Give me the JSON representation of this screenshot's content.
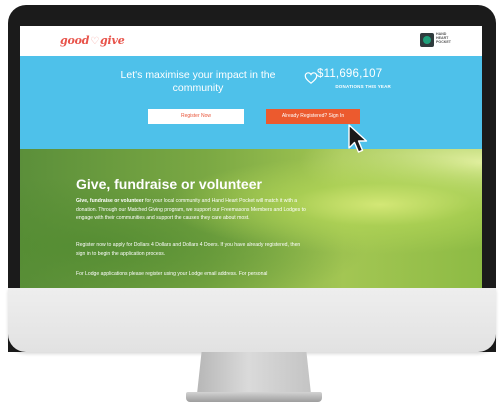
{
  "header": {
    "logo": {
      "left": "good",
      "heart": "♡",
      "right": "give"
    },
    "partner_logo_text": [
      "HAND",
      "HEART",
      "POCKET"
    ]
  },
  "hero": {
    "headline": "Let's maximise your impact in the community",
    "donation_amount": "$11,696,107",
    "donation_label": "DONATIONS THIS YEAR",
    "register_button": "Register Now",
    "signin_button": "Already Registered? Sign In"
  },
  "content": {
    "title": "Give, fundraise or volunteer",
    "para1_bold": "Give, fundraise or volunteer",
    "para1_rest": " for your local community and Hand Heart Pocket will match it with a donation. Through our Matched Giving program, we support our Freemasons Members and Lodges to engage with their communities and support the causes they care about most.",
    "para2": "Register now to apply for Dollars 4 Dollars and Dollars 4 Doers. If you have already registered, then sign in to begin the application process.",
    "para3": "For Lodge applications please register using your Lodge email address. For personal"
  },
  "colors": {
    "hero_bg": "#4ec1ea",
    "accent": "#ec5a2e",
    "logo": "#e8534a"
  },
  "icons": [
    "heart-icon",
    "cursor-icon",
    "hand-heart-pocket-logo"
  ]
}
